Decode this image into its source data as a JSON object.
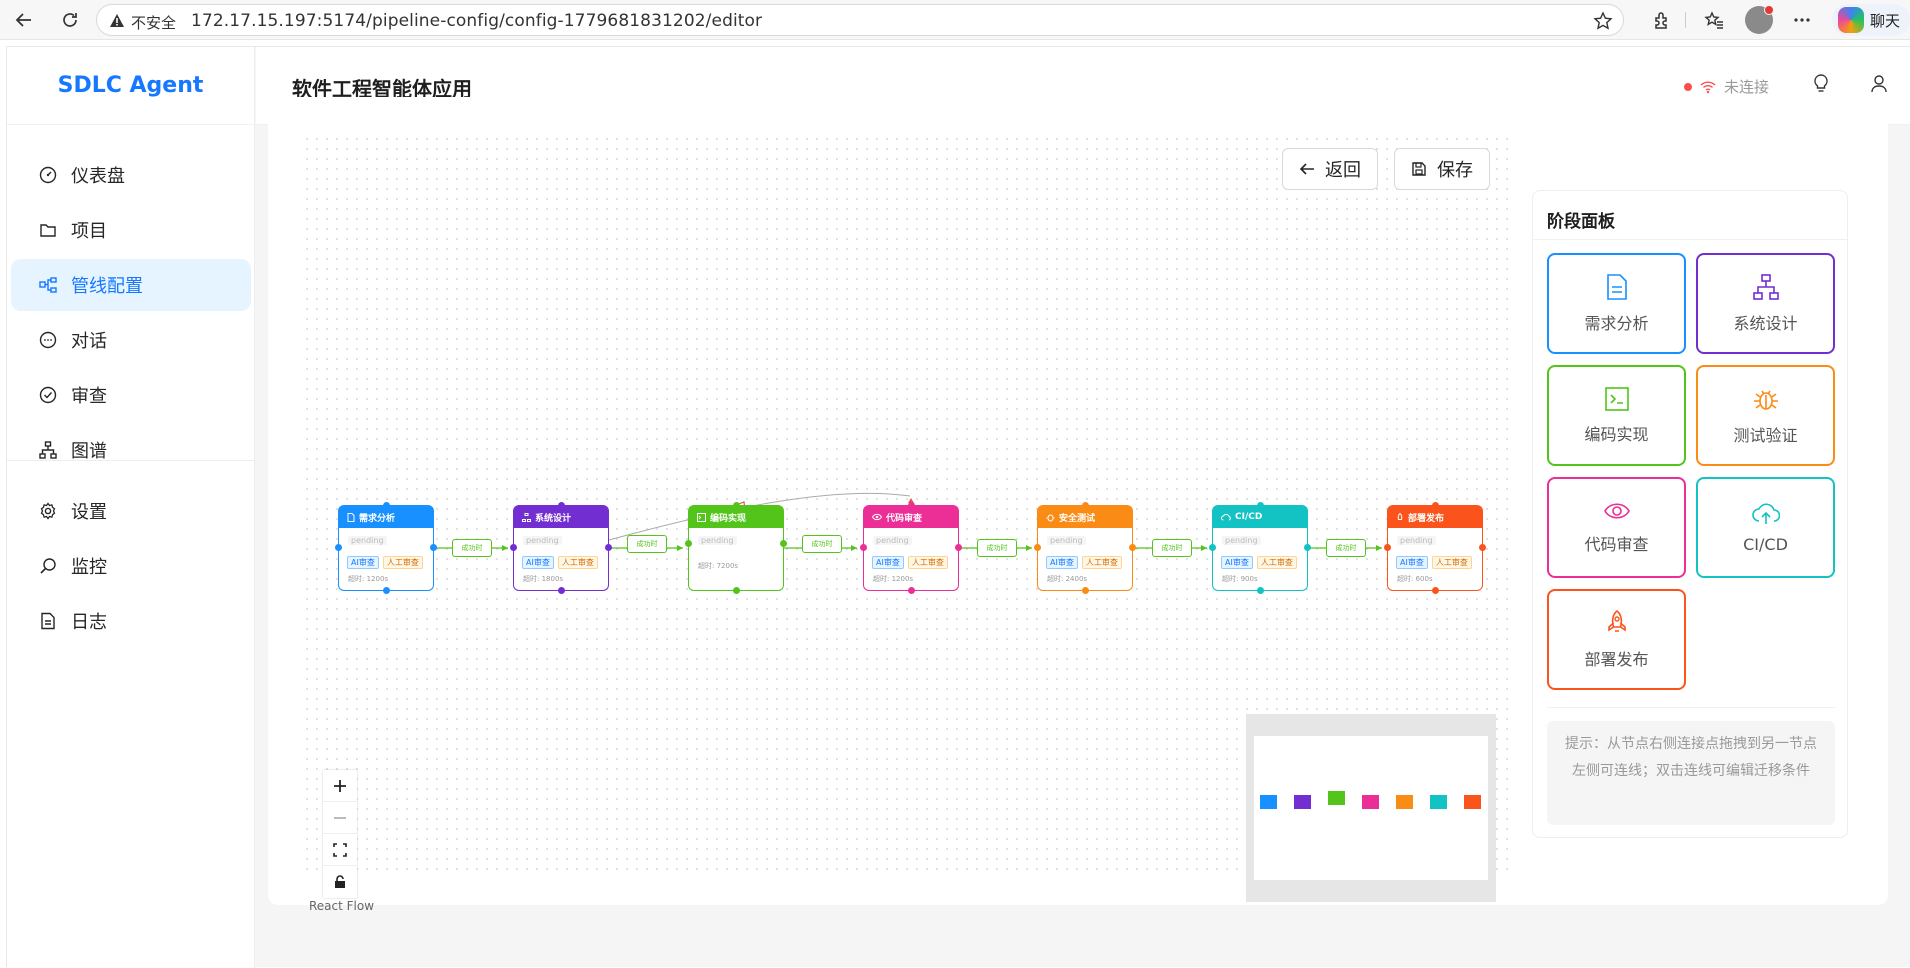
{
  "browser": {
    "insecure_label": "不安全",
    "url": "172.17.15.197:5174/pipeline-config/config-1779681831202/editor",
    "chat_label": "聊天"
  },
  "app": {
    "brand": "SDLC Agent",
    "header_title": "软件工程智能体应用",
    "status": "未连接"
  },
  "menu": {
    "dashboard": "仪表盘",
    "projects": "项目",
    "pipeline": "管线配置",
    "chat": "对话",
    "review": "审查",
    "graph": "图谱",
    "settings": "设置",
    "monitor": "监控",
    "logs": "日志"
  },
  "toolbar": {
    "back": "返回",
    "save": "保存"
  },
  "flow": {
    "status": "pending",
    "ai_tag": "AI审查",
    "human_tag": "人工审查",
    "edge_label": "成功时",
    "attribution": "React Flow",
    "nodes": [
      {
        "label": "需求分析",
        "timeout": "超时: 1200s",
        "color": "#1890ff"
      },
      {
        "label": "系统设计",
        "timeout": "超时: 1800s",
        "color": "#722ed1"
      },
      {
        "label": "编码实现",
        "timeout": "超时: 7200s",
        "color": "#52c41a"
      },
      {
        "label": "代码审查",
        "timeout": "超时: 1200s",
        "color": "#eb2f96"
      },
      {
        "label": "安全测试",
        "timeout": "超时: 2400s",
        "color": "#fa8c16"
      },
      {
        "label": "CI/CD",
        "timeout": "超时: 900s",
        "color": "#13c2c2"
      },
      {
        "label": "部署发布",
        "timeout": "超时: 600s",
        "color": "#fa541c"
      }
    ]
  },
  "palette": {
    "title": "阶段面板",
    "items": [
      {
        "label": "需求分析",
        "icon": "file-icon",
        "color": "#1890ff"
      },
      {
        "label": "系统设计",
        "icon": "hierarchy-icon",
        "color": "#722ed1"
      },
      {
        "label": "编码实现",
        "icon": "terminal-icon",
        "color": "#52c41a"
      },
      {
        "label": "测试验证",
        "icon": "bug-icon",
        "color": "#fa8c16"
      },
      {
        "label": "代码审查",
        "icon": "eye-icon",
        "color": "#eb2f96"
      },
      {
        "label": "CI/CD",
        "icon": "cloud-upload-icon",
        "color": "#13c2c2"
      },
      {
        "label": "部署发布",
        "icon": "rocket-icon",
        "color": "#fa541c"
      }
    ],
    "hint": "提示：从节点右侧连接点拖拽到另一节点左侧可连线；双击连线可编辑迁移条件"
  }
}
